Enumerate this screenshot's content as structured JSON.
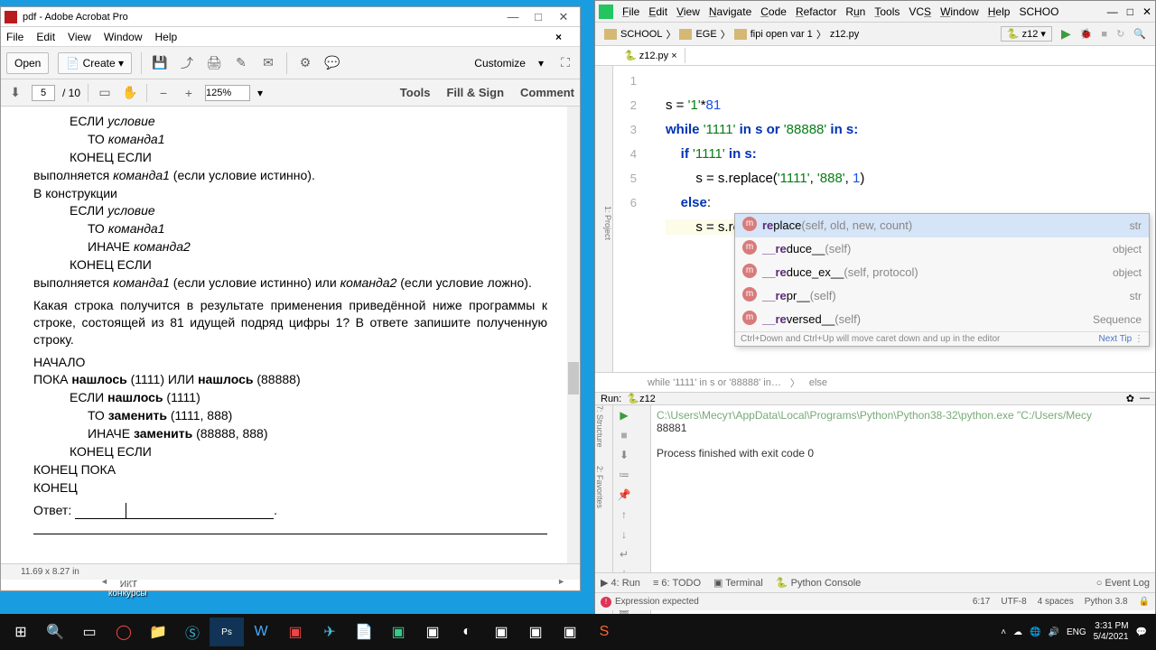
{
  "acrobat": {
    "title": "pdf - Adobe Acrobat Pro",
    "menu": [
      "File",
      "Edit",
      "View",
      "Window",
      "Help"
    ],
    "open": "Open",
    "create": "Create",
    "page": "5",
    "pages": "/ 10",
    "zoom": "125%",
    "rightLinks": [
      "Tools",
      "Fill & Sign",
      "Comment"
    ],
    "customize": "Customize",
    "status": "11.69 x 8.27 in",
    "doc": {
      "l1a": "ЕСЛИ ",
      "l1b": "условие",
      "l2a": "ТО ",
      "l2b": "команда1",
      "l3": "КОНЕЦ ЕСЛИ",
      "l4a": "выполняется ",
      "l4b": "команда1",
      "l4c": " (если условие истинно).",
      "l5": "В конструкции",
      "l6a": "ЕСЛИ ",
      "l6b": "условие",
      "l7a": "ТО ",
      "l7b": "команда1",
      "l8a": "ИНАЧЕ ",
      "l8b": "команда2",
      "l9": "КОНЕЦ ЕСЛИ",
      "l10a": "выполняется ",
      "l10b": "команда1 ",
      "l10c": "(если условие истинно) или ",
      "l10d": "команда2 ",
      "l10e": "(если условие ложно).",
      "l11": "Какая строка получится в результате применения приведённой ниже программы к строке, состоящей из 81 идущей подряд цифры 1? В ответе запишите полученную строку.",
      "l12": "НАЧАЛО",
      "l13a": "ПОКА  ",
      "l13b": "нашлось",
      "l13c": " (1111)  ИЛИ ",
      "l13d": "нашлось",
      "l13e": " (88888)",
      "l14a": "ЕСЛИ  ",
      "l14b": "нашлось",
      "l14c": " (1111)",
      "l15a": "ТО ",
      "l15b": "заменить",
      "l15c": " (1111, 888)",
      "l16a": "ИНАЧЕ ",
      "l16b": "заменить",
      "l16c": " (88888, 888)",
      "l17": "КОНЕЦ ЕСЛИ",
      "l18": "КОНЕЦ ПОКА",
      "l19": "КОНЕЦ",
      "l20": "Ответ: "
    }
  },
  "desktop": {
    "l1": "ИКТ",
    "l2": "конкурсы"
  },
  "pycharm": {
    "menu": [
      "File",
      "Edit",
      "View",
      "Navigate",
      "Code",
      "Refactor",
      "Run",
      "Tools",
      "VCS",
      "Window",
      "Help"
    ],
    "projName": "SCHOO",
    "crumbs": [
      "SCHOOL",
      "EGE",
      "fipi open var 1",
      "z12.py"
    ],
    "runsel": "z12",
    "tabname": "z12.py",
    "sidetab1": "1: Project",
    "sidetab2": "7: Structure",
    "sidetab3": "2: Favorites",
    "code": {
      "l1a": "s = ",
      "l1s": "'1'",
      "l1b": "*",
      "l1n": "81",
      "l2a": "while ",
      "l2s1": "'1111'",
      "l2b": " in s or ",
      "l2s2": "'88888'",
      "l2c": " in s:",
      "l3a": "    if ",
      "l3s": "'1111'",
      "l3b": " in s:",
      "l4a": "        s = s.replace(",
      "l4s1": "'1111'",
      "l4b": ", ",
      "l4s2": "'888'",
      "l4c": ", ",
      "l4n": "1",
      "l4d": ")",
      "l5a": "    else",
      "l5b": ":",
      "l6a": "        s = s.re"
    },
    "autoc": {
      "r1n": "re",
      "r1p": "place",
      "r1a": "(self, old, new, count)",
      "r1t": "str",
      "r2n": "__re",
      "r2p": "duce__",
      "r2a": "(self)",
      "r2t": "object",
      "r3n": "__re",
      "r3p": "duce_ex__",
      "r3a": "(self, protocol)",
      "r3t": "object",
      "r4n": "__re",
      "r4p": "pr__",
      "r4a": "(self)",
      "r4t": "str",
      "r5n": "__re",
      "r5p": "versed__",
      "r5a": "(self)",
      "r5t": "Sequence",
      "foot": "Ctrl+Down and Ctrl+Up will move caret down and up in the editor",
      "next": "Next Tip"
    },
    "breadcrumb1": "while '1111' in s or '88888' in…",
    "breadcrumb2": "else",
    "runLabel": "Run:",
    "runName": "z12",
    "out1": "C:\\Users\\Mecyт\\AppData\\Local\\Programs\\Python\\Python38-32\\python.exe \"C:/Users/Mecy",
    "out2": "88881",
    "out3": "",
    "out4": "Process finished with exit code 0",
    "bottomTabs": [
      "4: Run",
      "6: TODO",
      "Terminal",
      "Python Console"
    ],
    "eventLog": "Event Log",
    "statusErr": "Expression expected",
    "statusR": [
      "6:17",
      "UTF-8",
      "4 spaces",
      "Python 3.8"
    ]
  },
  "taskbar": {
    "lang": "ENG",
    "time": "3:31 PM",
    "date": "5/4/2021"
  }
}
